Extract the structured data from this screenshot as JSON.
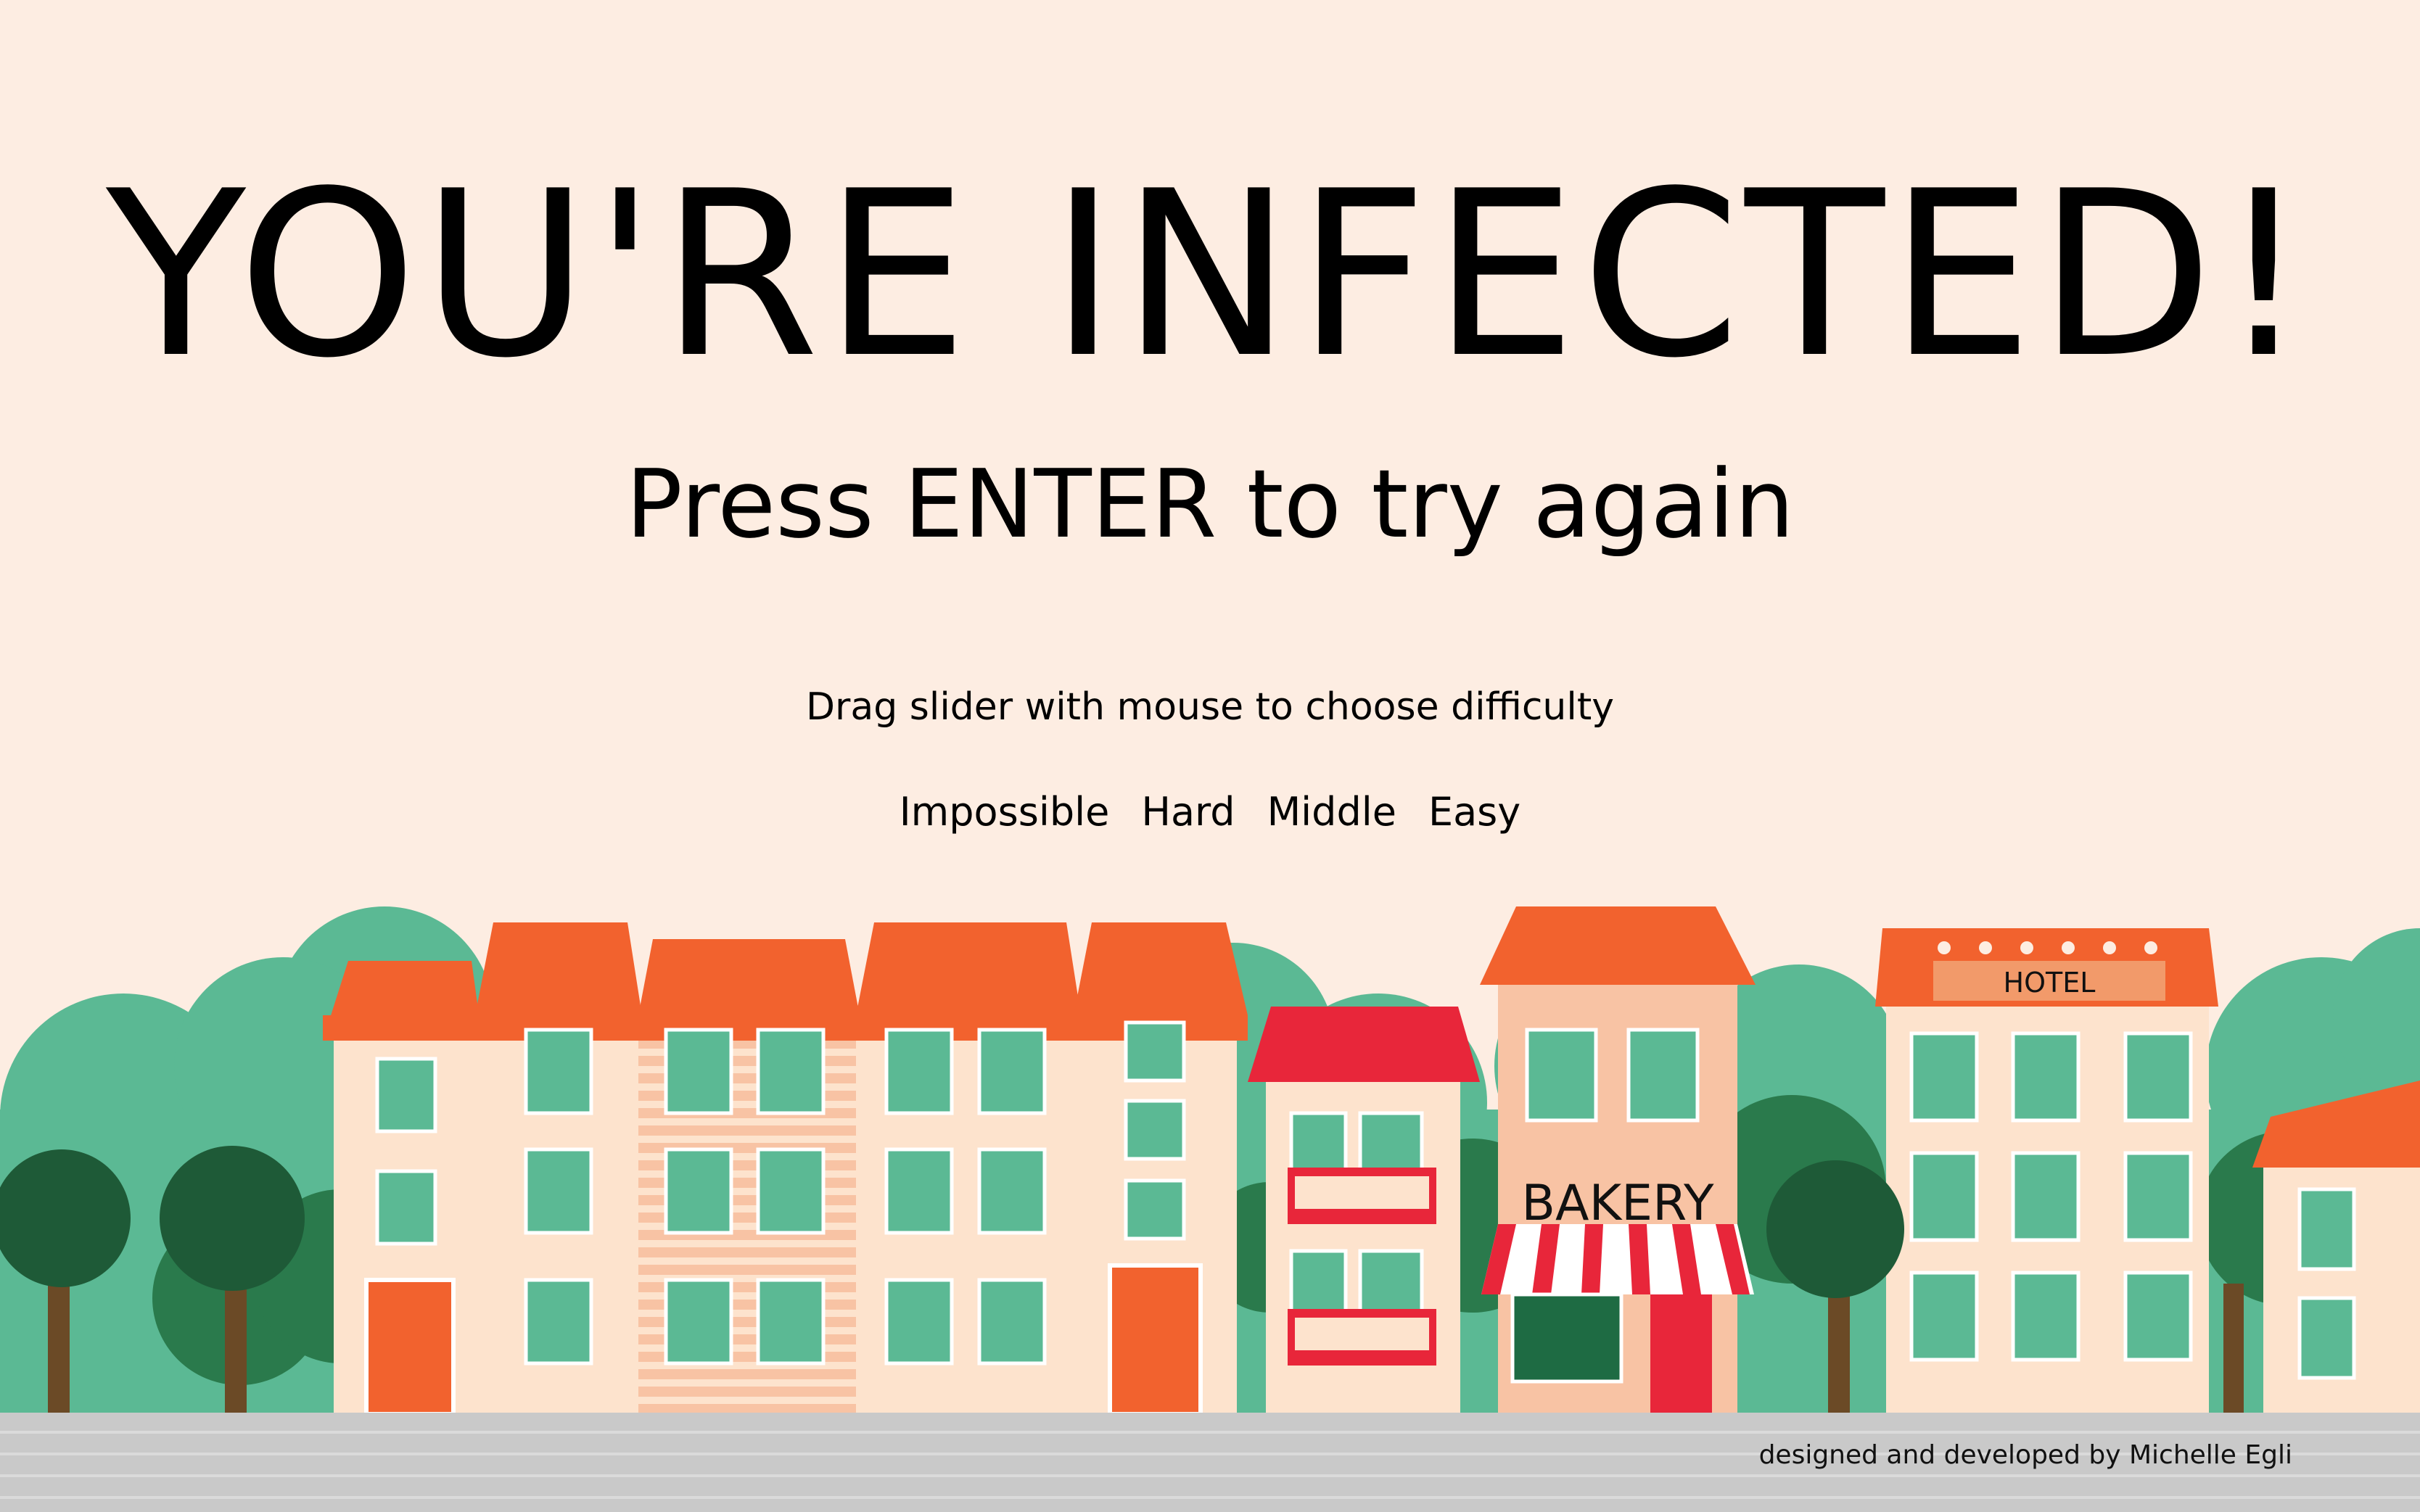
{
  "title": "YOU'RE INFECTED!",
  "subtitle": "Press ENTER to try again",
  "instruction": "Drag slider with mouse to choose difficulty",
  "difficulty": {
    "options": [
      "Impossible",
      "Hard",
      "Middle",
      "Easy"
    ]
  },
  "signs": {
    "bakery": "BAKERY",
    "hotel": "HOTEL"
  },
  "credit": "designed and developed by Michelle Egli",
  "colors": {
    "background": "#fdede2",
    "roof": "#f2622e",
    "roof_red": "#e8263a",
    "wall": "#fde3cd",
    "window": "#5bb994",
    "tree_light": "#5bb994",
    "tree_dark": "#1e6b43",
    "sidewalk": "#c9c9c9"
  }
}
